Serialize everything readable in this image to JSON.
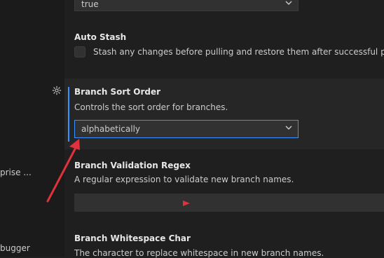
{
  "sidebar": {
    "frag_enterprise": "prise ...",
    "frag_debugger": "bugger"
  },
  "settings": {
    "top_dropdown": {
      "value": "true"
    },
    "auto_stash": {
      "title": "Auto Stash",
      "description": "Stash any changes before pulling and restore them after successful pull.",
      "checked": false
    },
    "branch_sort_order": {
      "title": "Branch Sort Order",
      "description": "Controls the sort order for branches.",
      "selected": "alphabetically"
    },
    "branch_validation_regex": {
      "title": "Branch Validation Regex",
      "description": "A regular expression to validate new branch names.",
      "value": ""
    },
    "branch_whitespace_char": {
      "title": "Branch Whitespace Char",
      "description": "The character to replace whitespace in new branch names."
    }
  },
  "icons": {
    "gear": "gear-icon",
    "chevron": "chevron-down-icon"
  },
  "colors": {
    "accent": "#3794ff",
    "annotation": "#e0323c"
  }
}
